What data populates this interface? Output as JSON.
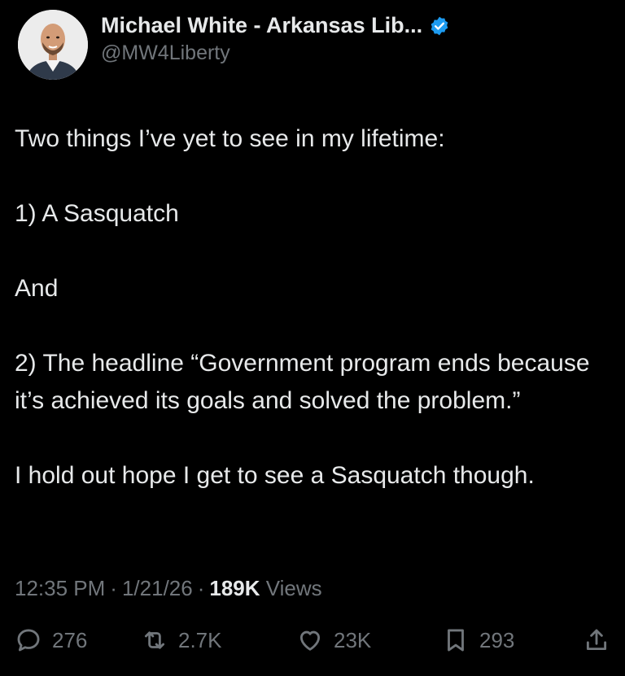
{
  "author": {
    "display_name": "Michael White - Arkansas Lib...",
    "handle": "@MW4Liberty",
    "verified": true,
    "verified_color": "#1d9bf0"
  },
  "tweet": {
    "lines": [
      "Two things I’ve yet to see in my lifetime:",
      "1) A Sasquatch",
      "And",
      "2) The headline “Government program ends because it’s achieved its goals and solved the problem.”",
      "I hold out hope I get to see a Sasquatch though."
    ]
  },
  "meta": {
    "time": "12:35 PM",
    "date": "1/21/26",
    "views_count": "189K",
    "views_label": "Views"
  },
  "actions": {
    "replies": "276",
    "reposts": "2.7K",
    "likes": "23K",
    "bookmarks": "293"
  },
  "icons": {
    "reply": "reply-icon",
    "repost": "repost-icon",
    "like": "heart-icon",
    "bookmark": "bookmark-icon",
    "share": "share-icon",
    "verified": "verified-badge-icon"
  }
}
